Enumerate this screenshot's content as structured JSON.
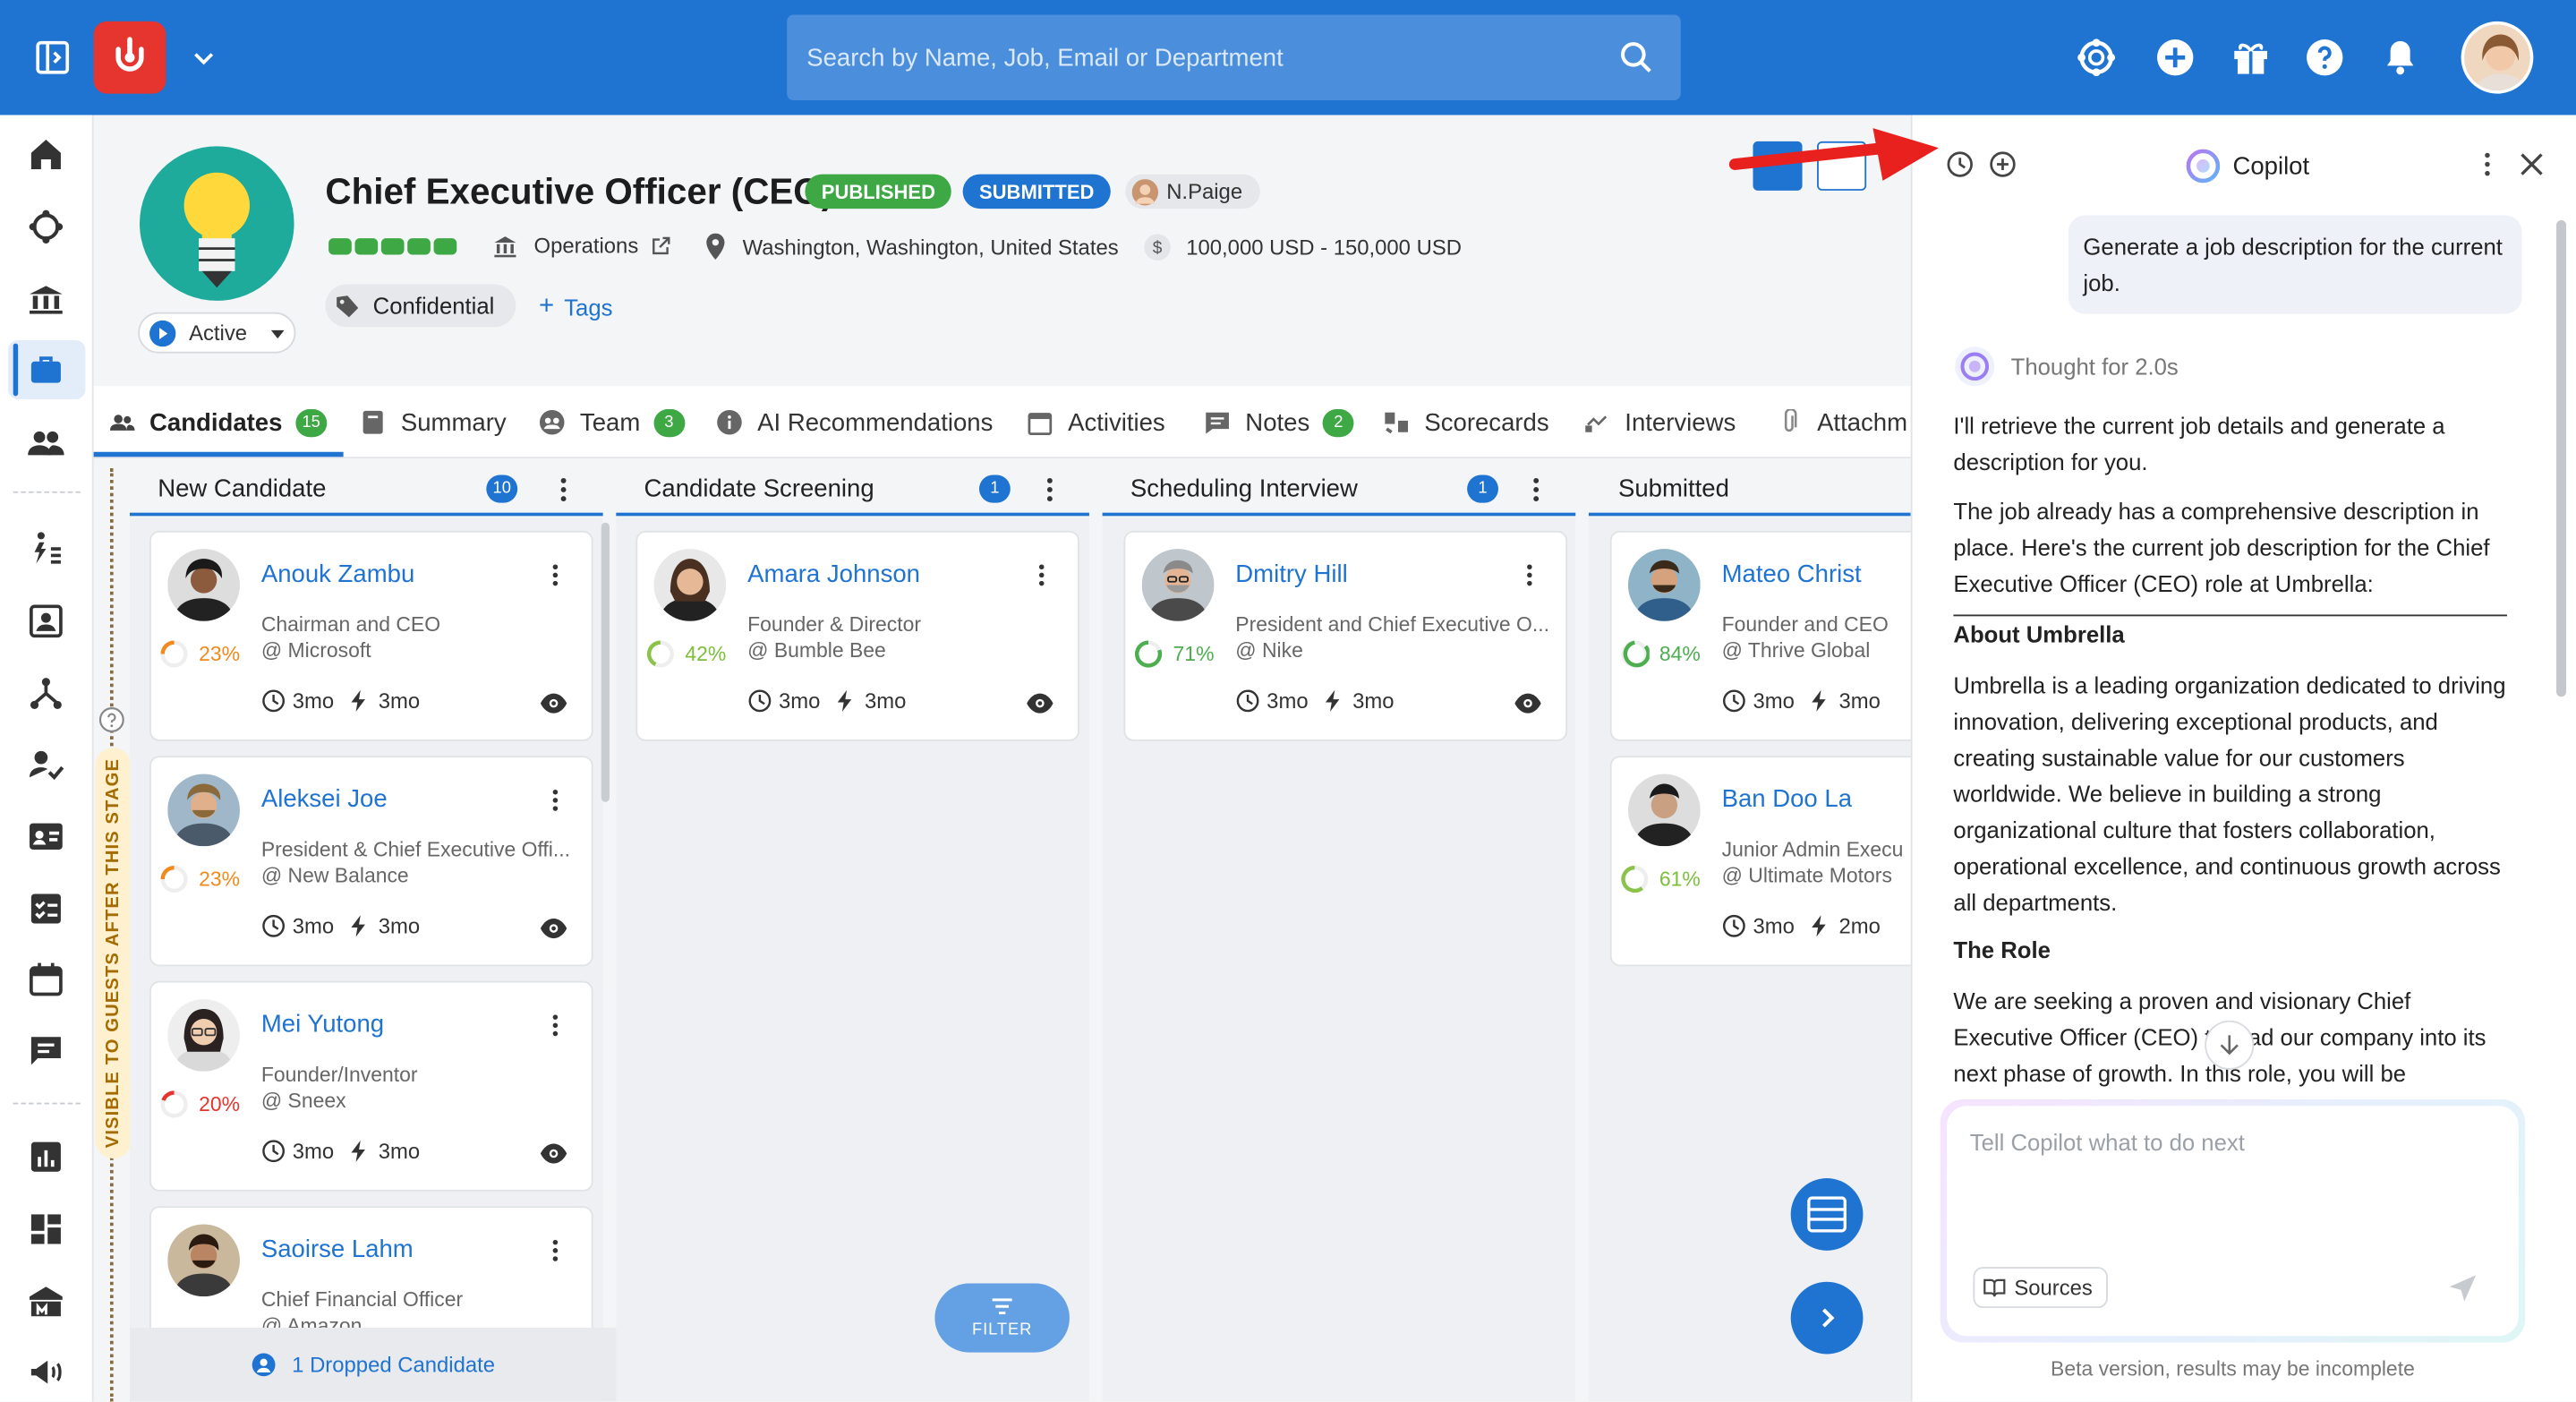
{
  "topbar": {
    "search_placeholder": "Search by Name, Job, Email or Department",
    "icons": [
      "sidebar-toggle-icon",
      "app-logo",
      "chevron-down-icon",
      "search-icon",
      "ai-assistant-icon",
      "add-icon",
      "gift-icon",
      "help-icon",
      "notifications-icon",
      "avatar"
    ]
  },
  "job": {
    "title": "Chief Executive Officer (CEO)",
    "badge_published": "PUBLISHED",
    "badge_submitted": "SUBMITTED",
    "owner": "N.Paige",
    "department": "Operations",
    "location": "Washington, Washington, United States",
    "salary": "100,000 USD - 150,000 USD",
    "status": "Active",
    "confidential": "Confidential",
    "tags": "Tags",
    "progress_steps": 5
  },
  "tabs": [
    {
      "label": "Candidates",
      "count": "15"
    },
    {
      "label": "Summary"
    },
    {
      "label": "Team",
      "count": "3"
    },
    {
      "label": "AI Recommendations"
    },
    {
      "label": "Activities"
    },
    {
      "label": "Notes",
      "count": "2"
    },
    {
      "label": "Scorecards"
    },
    {
      "label": "Interviews"
    },
    {
      "label": "Attachm"
    }
  ],
  "board": {
    "visible_label": "VISIBLE TO GUESTS AFTER THIS STAGE",
    "stages": [
      {
        "name": "New Candidate",
        "count": "10"
      },
      {
        "name": "Candidate Screening",
        "count": "1"
      },
      {
        "name": "Scheduling Interview",
        "count": "1"
      },
      {
        "name": "Submitted"
      }
    ],
    "cards": [
      {
        "name": "Anouk Zambu",
        "role": "Chairman and CEO",
        "company": "@ Microsoft",
        "score": "23%",
        "t1": "3mo",
        "t2": "3mo"
      },
      {
        "name": "Aleksei Joe",
        "role": "President & Chief Executive Offi...",
        "company": "@ New Balance",
        "score": "23%",
        "t1": "3mo",
        "t2": "3mo"
      },
      {
        "name": "Mei Yutong",
        "role": "Founder/Inventor",
        "company": "@ Sneex",
        "score": "20%",
        "t1": "3mo",
        "t2": "3mo"
      },
      {
        "name": "Saoirse Lahm",
        "role": "Chief Financial Officer",
        "company": "@ Amazon",
        "score": "",
        "t1": "",
        "t2": ""
      },
      {
        "name": "Amara Johnson",
        "role": "Founder & Director",
        "company": "@ Bumble Bee",
        "score": "42%",
        "t1": "3mo",
        "t2": "3mo"
      },
      {
        "name": "Dmitry Hill",
        "role": "President and Chief Executive O...",
        "company": "@ Nike",
        "score": "71%",
        "t1": "3mo",
        "t2": "3mo"
      },
      {
        "name": "Mateo Christ",
        "role": "Founder and CEO",
        "company": "@ Thrive Global",
        "score": "84%",
        "t1": "3mo",
        "t2": "3mo"
      },
      {
        "name": "Ban Doo La",
        "role": "Junior Admin Execu",
        "company": "@ Ultimate Motors",
        "score": "61%",
        "t1": "3mo",
        "t2": "2mo"
      }
    ],
    "dropped": "1 Dropped Candidate",
    "filter": "FILTER"
  },
  "copilot": {
    "title": "Copilot",
    "user_message": "Generate a job description for the current job.",
    "thought": "Thought for 2.0s",
    "p1": "I'll retrieve the current job details and generate a description for you.",
    "p2": "The job already has a comprehensive description in place. Here's the current job description for the Chief Executive Officer (CEO) role at Umbrella:",
    "h1": "About Umbrella",
    "p3": "Umbrella is a leading organization dedicated to driving innovation, delivering exceptional products, and creating sustainable value for our customers worldwide. We believe in building a strong organizational culture that fosters collaboration, operational excellence, and continuous growth across all departments.",
    "h2": "The Role",
    "p4": "We are seeking a proven and visionary Chief Executive Officer (CEO) to lead our company into its next phase of growth. In this role, you will be",
    "input_placeholder": "Tell Copilot what to do next",
    "sources": "Sources",
    "beta": "Beta version, results may be incomplete"
  },
  "colors": {
    "brand_blue": "#1f73d1",
    "logo_red": "#e5352e",
    "published_green": "#3da844",
    "score_orange": "#f08a1c",
    "score_red": "#e5352e",
    "score_green": "#4cae4f"
  }
}
